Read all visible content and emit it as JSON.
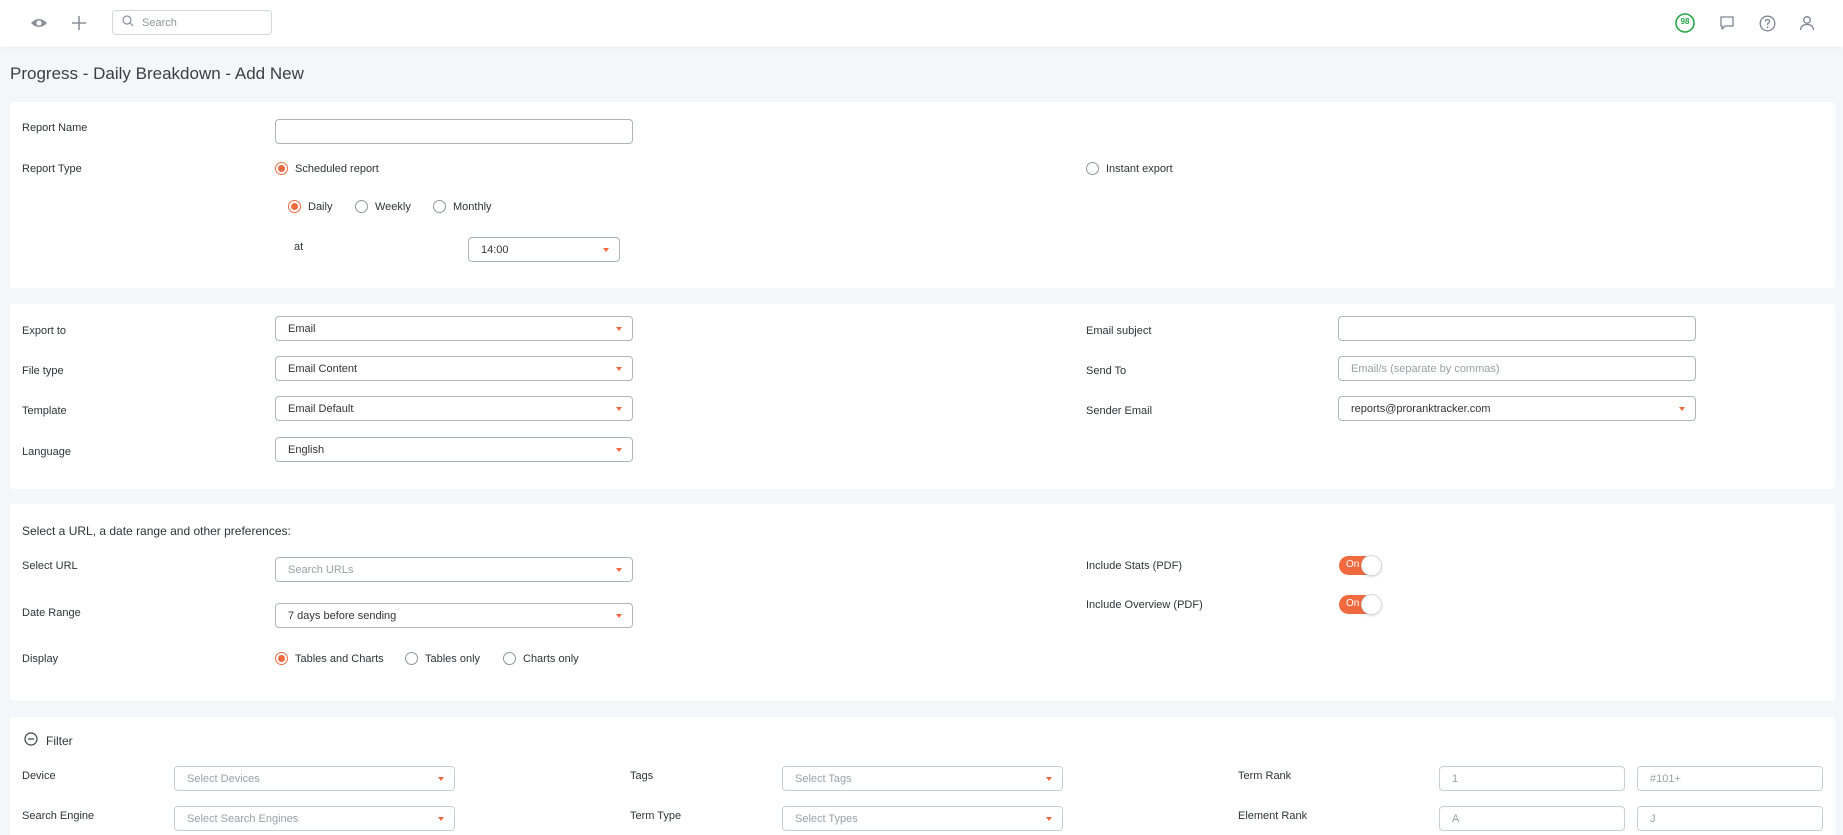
{
  "topbar": {
    "search_placeholder": "Search",
    "badge_count": "98"
  },
  "page_title": "Progress - Daily Breakdown - Add New",
  "report": {
    "name_label": "Report Name",
    "name_value": "",
    "type_label": "Report Type",
    "scheduled_label": "Scheduled report",
    "instant_label": "Instant export",
    "daily_label": "Daily",
    "weekly_label": "Weekly",
    "monthly_label": "Monthly",
    "at_label": "at",
    "time_value": "14:00"
  },
  "export": {
    "export_to_label": "Export to",
    "export_to_value": "Email",
    "file_type_label": "File type",
    "file_type_value": "Email Content",
    "template_label": "Template",
    "template_value": "Email Default",
    "language_label": "Language",
    "language_value": "English",
    "email_subject_label": "Email subject",
    "email_subject_value": "",
    "send_to_label": "Send To",
    "send_to_placeholder": "Email/s (separate by commas)",
    "sender_email_label": "Sender Email",
    "sender_email_value": "reports@proranktracker.com"
  },
  "prefs": {
    "heading": "Select a URL, a date range and other preferences:",
    "select_url_label": "Select URL",
    "select_url_placeholder": "Search URLs",
    "date_range_label": "Date Range",
    "date_range_value": "7 days before sending",
    "display_label": "Display",
    "display_options": [
      "Tables and Charts",
      "Tables only",
      "Charts only"
    ],
    "include_stats_label": "Include Stats (PDF)",
    "include_overview_label": "Include Overview (PDF)",
    "toggle_on_text": "On"
  },
  "filter": {
    "heading": "Filter",
    "device_label": "Device",
    "device_placeholder": "Select Devices",
    "search_engine_label": "Search Engine",
    "search_engine_placeholder": "Select Search Engines",
    "tags_label": "Tags",
    "tags_placeholder": "Select Tags",
    "term_type_label": "Term Type",
    "term_type_placeholder": "Select Types",
    "term_rank_label": "Term Rank",
    "term_rank_from": "1",
    "term_rank_to": "#101+",
    "element_rank_label": "Element Rank",
    "element_rank_from": "A",
    "element_rank_to": "J"
  },
  "colors": {
    "accent": "#f16a3f",
    "badge": "#27a745"
  }
}
